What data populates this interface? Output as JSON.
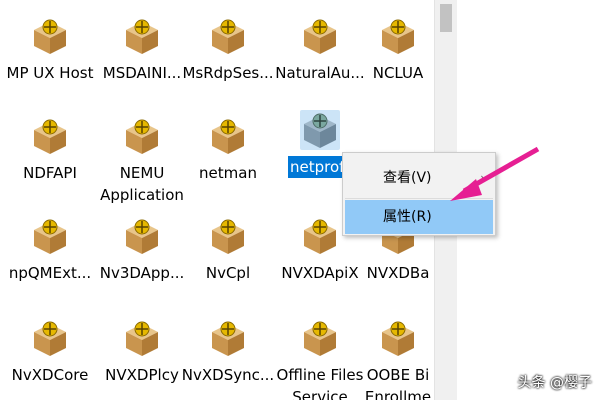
{
  "folders": [
    [
      "MP UX Host",
      "MSDAINI...",
      "MsRdpSes...",
      "NaturalAu...",
      "NCLUA"
    ],
    [
      "NDFAPI",
      "NEMU Application",
      "netman",
      "netprof",
      ""
    ],
    [
      "npQMExt...",
      "Nv3DApp...",
      "NvCpl",
      "NVXDApiX",
      "NVXDBa"
    ],
    [
      "NvXDCore",
      "NVXDPlcy",
      "NvXDSync...",
      "Offline Files Service",
      "OOBE Bi Enrollme"
    ]
  ],
  "context_menu": {
    "view_label": "查看(V)",
    "view_arrow": "›",
    "properties_label": "属性(R)"
  },
  "watermark": "头条 @樱子",
  "colors": {
    "selection_bg": "#0078d7",
    "menu_hover": "#91c9f7",
    "annotation_arrow": "#e61f93"
  }
}
